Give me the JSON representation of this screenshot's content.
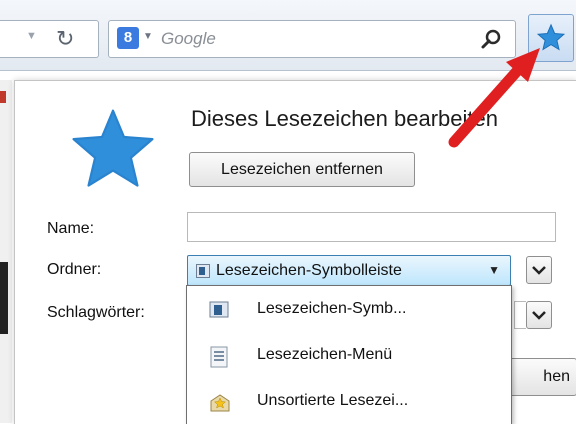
{
  "toolbar": {
    "search_engine_badge": "8",
    "search_placeholder": "Google",
    "icons": [
      "dropdown-arrow-icon",
      "reload-icon",
      "search-engine-icon",
      "magnifier-icon",
      "bookmark-star-icon"
    ],
    "accent_color": "#2f8fdb"
  },
  "panel": {
    "title": "Dieses Lesezeichen bearbeiten",
    "remove_button": "Lesezeichen entfernen",
    "name_label": "Name:",
    "name_value": "",
    "folder_label": "Ordner:",
    "folder_value": "Lesezeichen-Symbolleiste",
    "tags_label": "Schlagwörter:",
    "done_button_partial": "hen"
  },
  "folder_dropdown": {
    "items": [
      {
        "label": "Lesezeichen-Symb...",
        "icon": "toolbar-folder-icon"
      },
      {
        "label": "Lesezeichen-Menü",
        "icon": "menu-folder-icon"
      },
      {
        "label": "Unsortierte Lesezei...",
        "icon": "unsorted-folder-icon"
      }
    ]
  },
  "annotation": {
    "arrow_color": "#e02020"
  }
}
